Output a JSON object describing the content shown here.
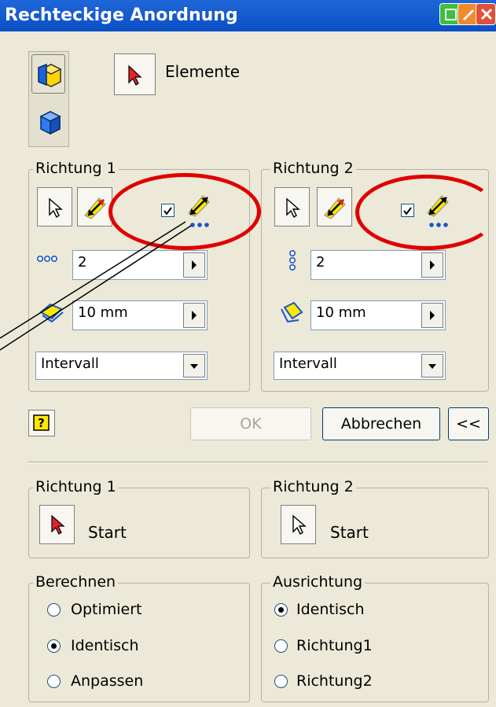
{
  "window": {
    "title": "Rechteckige Anordnung"
  },
  "top": {
    "elements_label": "Elemente"
  },
  "direction1": {
    "group_label": "Richtung 1",
    "count_value": "2",
    "spacing_value": "10 mm",
    "mode_value": "Intervall"
  },
  "direction2": {
    "group_label": "Richtung 2",
    "count_value": "2",
    "spacing_value": "10 mm",
    "mode_value": "Intervall"
  },
  "buttons": {
    "ok_label": "OK",
    "cancel_label": "Abbrechen",
    "less_label": "<<"
  },
  "start1": {
    "group_label": "Richtung 1",
    "start_label": "Start"
  },
  "start2": {
    "group_label": "Richtung 2",
    "start_label": "Start"
  },
  "berechnen": {
    "group_label": "Berechnen",
    "options": [
      "Optimiert",
      "Identisch",
      "Anpassen"
    ],
    "selected": "Identisch"
  },
  "ausrichtung": {
    "group_label": "Ausrichtung",
    "options": [
      "Identisch",
      "Richtung1",
      "Richtung2"
    ],
    "selected": "Identisch"
  },
  "colors": {
    "title_bar": "#0a4fc4",
    "dialog_bg": "#ece9d8",
    "highlight_ring": "#e00000"
  }
}
